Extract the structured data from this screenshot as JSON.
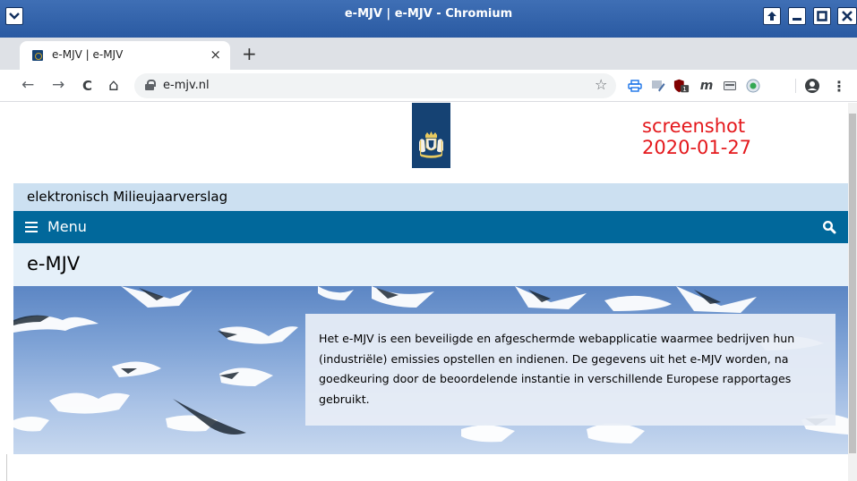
{
  "window": {
    "title": "e-MJV | e-MJV - Chromium"
  },
  "tabs": [
    {
      "title": "e-MJV | e-MJV"
    }
  ],
  "toolbar": {
    "url": "e-mjv.nl",
    "back_glyph": "←",
    "forward_glyph": "→",
    "reload_glyph": "C",
    "home_glyph": "⌂",
    "bookmark_glyph": "☆",
    "tab_close_glyph": "×",
    "new_tab_glyph": "+",
    "extension_badge": "1",
    "extension_m": "m",
    "menu_glyph": "⋮"
  },
  "page": {
    "stamp_line1": "screenshot",
    "stamp_line2": "2020-01-27",
    "subtitle": "elektronisch Milieujaarverslag",
    "menu_label": "Menu",
    "heading": "e-MJV",
    "hero_text": "Het e-MJV is een beveiligde en afgeschermde webapplicatie waarmee bedrijven hun (industriële) emissies opstellen en indienen. De gegevens uit het e-MJV worden, na goedkeuring door de beoordelende instantie in verschillende Europese rapportages gebruikt."
  },
  "colors": {
    "titlebar": "#2a5aa2",
    "brand_blue": "#154273",
    "menu_bar": "#01689b",
    "subtitle_bar": "#cce0f1",
    "heading_bar": "#e5f0f9",
    "stamp_red": "#e4181c"
  },
  "icons": {
    "window_menu": "chevron-down-icon",
    "window_buttons": [
      "maximize-up-icon",
      "minimize-icon",
      "restore-icon",
      "close-icon"
    ],
    "menu": "hamburger-icon",
    "search": "search-icon"
  }
}
